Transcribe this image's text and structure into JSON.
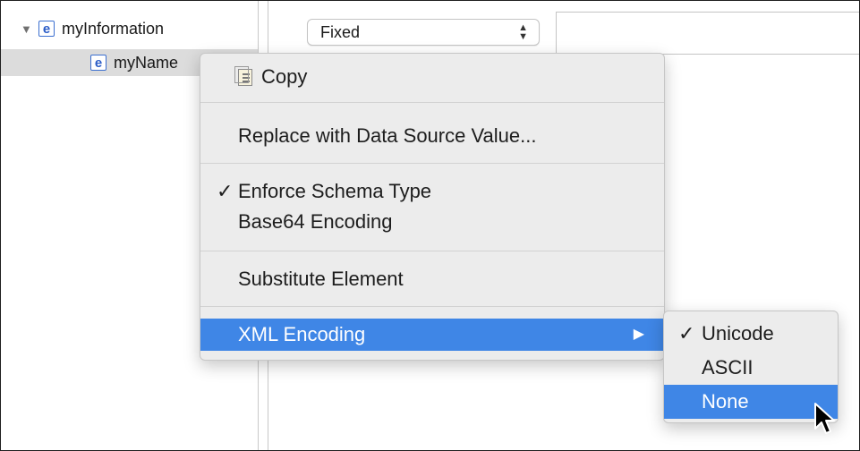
{
  "tree": {
    "items": [
      {
        "label": "myInformation",
        "badge": "e",
        "expanded": true
      },
      {
        "label": "myName",
        "badge": "e",
        "selected": true
      }
    ]
  },
  "editor": {
    "type_dropdown_value": "Fixed",
    "value_field": ""
  },
  "context_menu": {
    "copy": "Copy",
    "replace": "Replace with Data Source Value...",
    "enforce": "Enforce Schema Type",
    "enforce_checked": true,
    "base64": "Base64 Encoding",
    "substitute": "Substitute Element",
    "xml_encoding": "XML Encoding"
  },
  "submenu": {
    "items": [
      {
        "label": "Unicode",
        "checked": true
      },
      {
        "label": "ASCII",
        "checked": false
      },
      {
        "label": "None",
        "checked": false,
        "highlighted": true
      }
    ]
  },
  "colors": {
    "highlight": "#3f86e6",
    "menu_bg": "#ececec",
    "badge": "#2a5cc7"
  }
}
